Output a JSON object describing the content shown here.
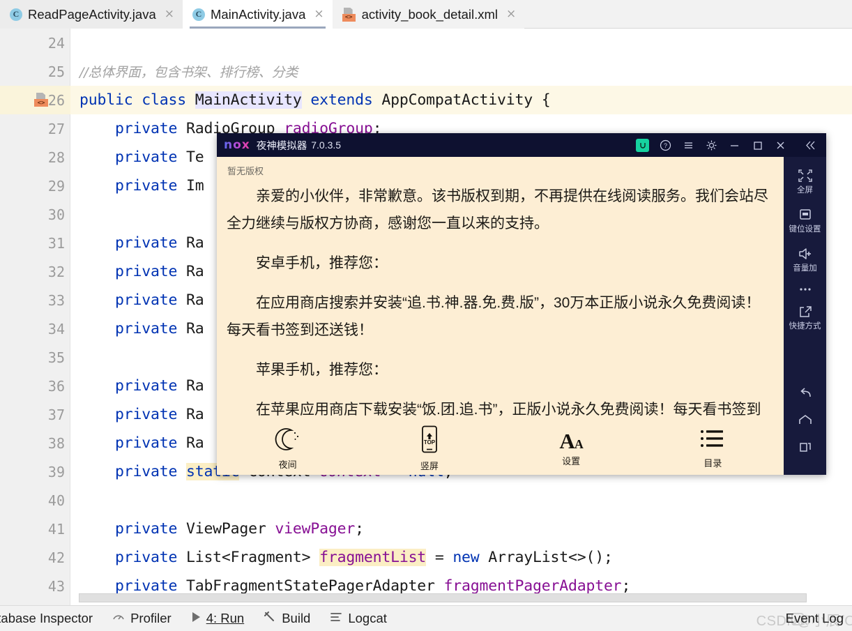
{
  "tabs": [
    {
      "label": "ReadPageActivity.java",
      "icon": "java-class-icon",
      "close": "×",
      "active": false
    },
    {
      "label": "MainActivity.java",
      "icon": "java-class-icon",
      "close": "×",
      "active": true
    },
    {
      "label": "activity_book_detail.xml",
      "icon": "xml-layout-icon",
      "close": "×",
      "active": false
    }
  ],
  "editor": {
    "lines": [
      {
        "no": "24",
        "text": ""
      },
      {
        "no": "25",
        "text": "//总体界面，包含书架、排行榜、分类"
      },
      {
        "no": "26",
        "text": "public class MainActivity extends AppCompatActivity {"
      },
      {
        "no": "27",
        "text": "    private RadioGroup radioGroup;"
      },
      {
        "no": "28",
        "text": "    private Te"
      },
      {
        "no": "29",
        "text": "    private Im"
      },
      {
        "no": "30",
        "text": ""
      },
      {
        "no": "31",
        "text": "    private Ra"
      },
      {
        "no": "32",
        "text": "    private Ra"
      },
      {
        "no": "33",
        "text": "    private Ra"
      },
      {
        "no": "34",
        "text": "    private Ra"
      },
      {
        "no": "35",
        "text": ""
      },
      {
        "no": "36",
        "text": "    private Ra"
      },
      {
        "no": "37",
        "text": "    private Ra"
      },
      {
        "no": "38",
        "text": "    private Ra"
      },
      {
        "no": "39",
        "text": "    private static Context context = null;"
      },
      {
        "no": "40",
        "text": ""
      },
      {
        "no": "41",
        "text": "    private ViewPager viewPager;"
      },
      {
        "no": "42",
        "text": "    private List<Fragment> fragmentList = new ArrayList<>();"
      },
      {
        "no": "43",
        "text": "    private TabFragmentStatePagerAdapter fragmentPagerAdapter;"
      }
    ],
    "tokens": {
      "comment25": "//总体界面，包含书架、排行榜、分类",
      "l26_public": "public",
      "l26_class": "class",
      "l26_name": "MainActivity",
      "l26_extends": "extends",
      "l26_super": "AppCompatActivity",
      "l26_brace": "{",
      "private": "private",
      "l27_type": "RadioGroup",
      "l27_field": "radioGroup",
      "l27_semi": ";",
      "l28_type": "Te",
      "l29_type": "Im",
      "l31_type": "Ra",
      "l39_static": "static",
      "l39_type": "Context",
      "l39_field": "context",
      "l39_eq": "=",
      "l39_null": "null",
      "l39_semi": ";",
      "l41_type": "ViewPager",
      "l41_field": "viewPager",
      "l41_semi": ";",
      "l42_type": "List<Fragment>",
      "l42_field": "fragmentList",
      "l42_eq": "=",
      "l42_new": "new",
      "l42_rest": "ArrayList<>();",
      "l43_type": "TabFragmentStatePagerAdapter",
      "l43_field": "fragmentPagerAdapter",
      "l43_semi": ";"
    },
    "gutter_icon_line": "26",
    "gutter_icon_name": "xml-layout-gutter-icon"
  },
  "nox": {
    "logo": "nox",
    "app_name": "夜神模拟器",
    "version": "7.0.3.5",
    "titlebar_icons": [
      {
        "name": "nox-account-icon"
      },
      {
        "name": "help-icon"
      },
      {
        "name": "menu-icon"
      },
      {
        "name": "settings-gear-icon"
      },
      {
        "name": "minimize-icon"
      },
      {
        "name": "maximize-icon"
      },
      {
        "name": "close-icon"
      },
      {
        "name": "collapse-sidebar-icon"
      }
    ],
    "sidebar": [
      {
        "name": "fullscreen-icon",
        "label": "全屏"
      },
      {
        "name": "keymap-icon",
        "label": "键位设置"
      },
      {
        "name": "volume-up-icon",
        "label": "音量加"
      },
      {
        "name": "more-icon",
        "label": ""
      },
      {
        "name": "shortcut-icon",
        "label": "快捷方式"
      }
    ],
    "sidebar_nav": [
      {
        "name": "back-icon"
      },
      {
        "name": "home-icon"
      },
      {
        "name": "recents-icon"
      }
    ],
    "reader": {
      "header": "暂无版权",
      "paragraphs": [
        "亲爱的小伙伴，非常歉意。该书版权到期，不再提供在线阅读服务。我们会站尽全力继续与版权方协商，感谢您一直以来的支持。",
        "安卓手机，推荐您：",
        "在应用商店搜索并安装“追.书.神.器.免.费.版”，30万本正版小说永久免费阅读！每天看书签到还送钱！",
        "苹果手机，推荐您：",
        "在苹果应用商店下载安装“饭.团.追.书”，正版小说永久免费阅读！每天看书签到还送钱。"
      ],
      "toolbar": [
        {
          "name": "night-mode-icon",
          "label": "夜间"
        },
        {
          "name": "portrait-mode-icon",
          "label": "竖屏",
          "glyph": "TOP"
        },
        {
          "name": "font-settings-icon",
          "label": "设置"
        },
        {
          "name": "catalog-icon",
          "label": "目录"
        }
      ]
    }
  },
  "statusbar": {
    "items": [
      {
        "name": "database-inspector",
        "label": "atabase Inspector",
        "icon": null
      },
      {
        "name": "profiler",
        "label": "Profiler",
        "icon": "profiler-icon"
      },
      {
        "name": "run",
        "label": "4: Run",
        "icon": "run-play-icon"
      },
      {
        "name": "build",
        "label": "Build",
        "icon": "build-hammer-icon"
      },
      {
        "name": "logcat",
        "label": "Logcat",
        "icon": "logcat-icon"
      }
    ],
    "event_log": "Event Log",
    "watermark": "CSDN@小辰/OPPO"
  },
  "colors": {
    "nox_titlebar": "#0e1130",
    "nox_sidebar": "#171a3c",
    "reader_bg": "#fdeed4",
    "accent_green": "#16d2a0",
    "xml_icon": "#ee8b5c",
    "java_icon": "#8ecbe5",
    "keyword": "#0033b3",
    "field": "#871094",
    "selection": "#e8e6ff",
    "identifier_highlight": "#fbeec4",
    "caret_row": "#fdf8e6"
  }
}
